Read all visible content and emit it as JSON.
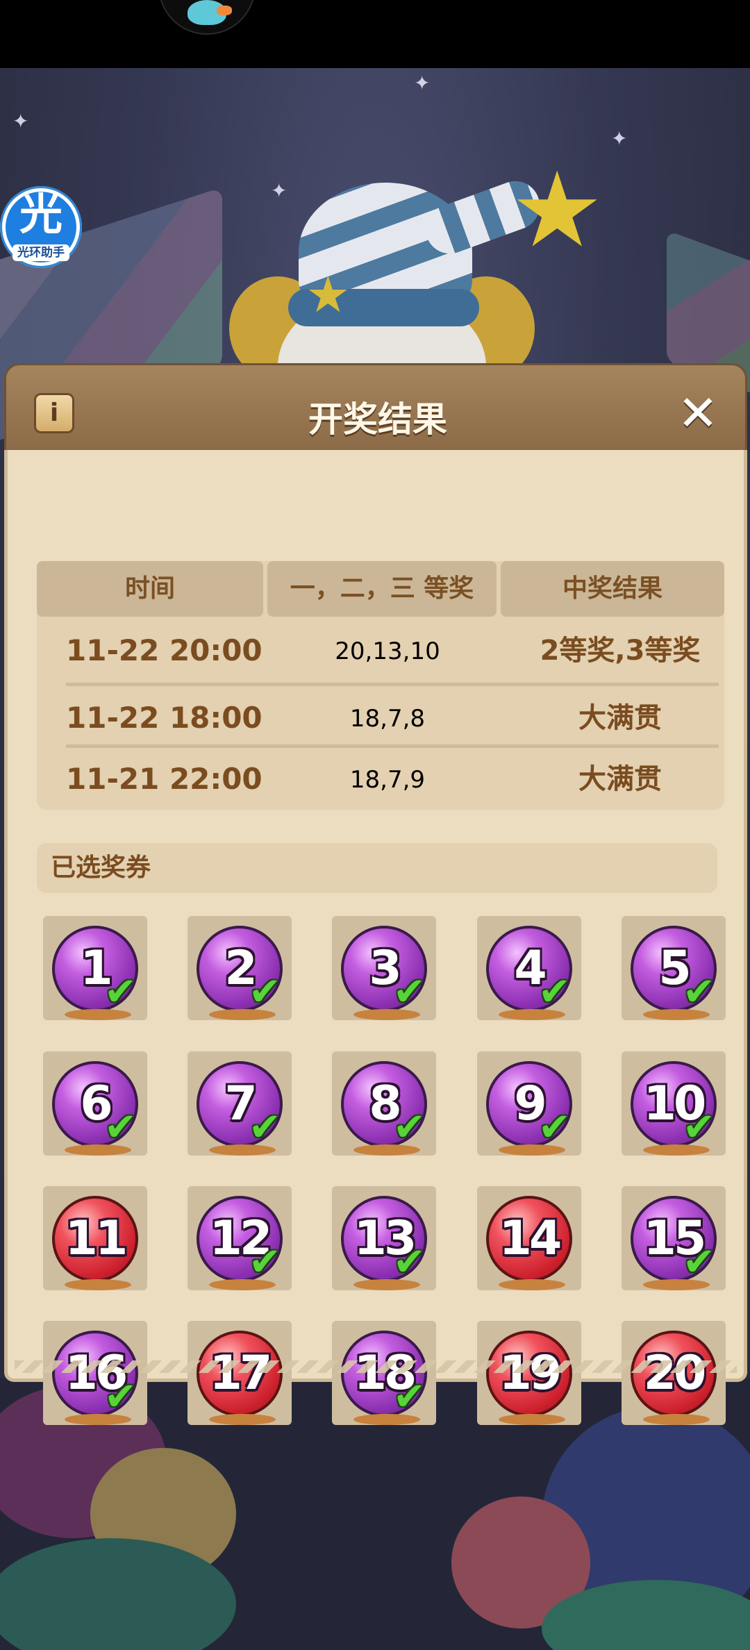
{
  "dialog": {
    "title": "开奖结果",
    "info_icon": "i",
    "close_icon": "✕"
  },
  "assistant_badge": {
    "glyph": "光",
    "caption": "光环助手"
  },
  "results_table": {
    "headers": [
      "时间",
      "一，二，三 等奖",
      "中奖结果"
    ],
    "rows": [
      {
        "time": "11-22 20:00",
        "numbers": "20,13,10",
        "result": "2等奖,3等奖"
      },
      {
        "time": "11-22 18:00",
        "numbers": "18,7,8",
        "result": "大满贯"
      },
      {
        "time": "11-21 22:00",
        "numbers": "18,7,9",
        "result": "大满贯"
      }
    ]
  },
  "selected_section": {
    "label": "已选奖券"
  },
  "tickets": [
    {
      "number": "1",
      "color": "purple",
      "selected": true
    },
    {
      "number": "2",
      "color": "purple",
      "selected": true
    },
    {
      "number": "3",
      "color": "purple",
      "selected": true
    },
    {
      "number": "4",
      "color": "purple",
      "selected": true
    },
    {
      "number": "5",
      "color": "purple",
      "selected": true
    },
    {
      "number": "6",
      "color": "purple",
      "selected": true
    },
    {
      "number": "7",
      "color": "purple",
      "selected": true
    },
    {
      "number": "8",
      "color": "purple",
      "selected": true
    },
    {
      "number": "9",
      "color": "purple",
      "selected": true
    },
    {
      "number": "10",
      "color": "purple",
      "selected": true
    },
    {
      "number": "11",
      "color": "red",
      "selected": false
    },
    {
      "number": "12",
      "color": "purple",
      "selected": true
    },
    {
      "number": "13",
      "color": "purple",
      "selected": true
    },
    {
      "number": "14",
      "color": "red",
      "selected": false
    },
    {
      "number": "15",
      "color": "purple",
      "selected": true
    },
    {
      "number": "16",
      "color": "purple",
      "selected": true
    },
    {
      "number": "17",
      "color": "red",
      "selected": false
    },
    {
      "number": "18",
      "color": "purple",
      "selected": true
    },
    {
      "number": "19",
      "color": "red",
      "selected": false
    },
    {
      "number": "20",
      "color": "red",
      "selected": false
    }
  ]
}
